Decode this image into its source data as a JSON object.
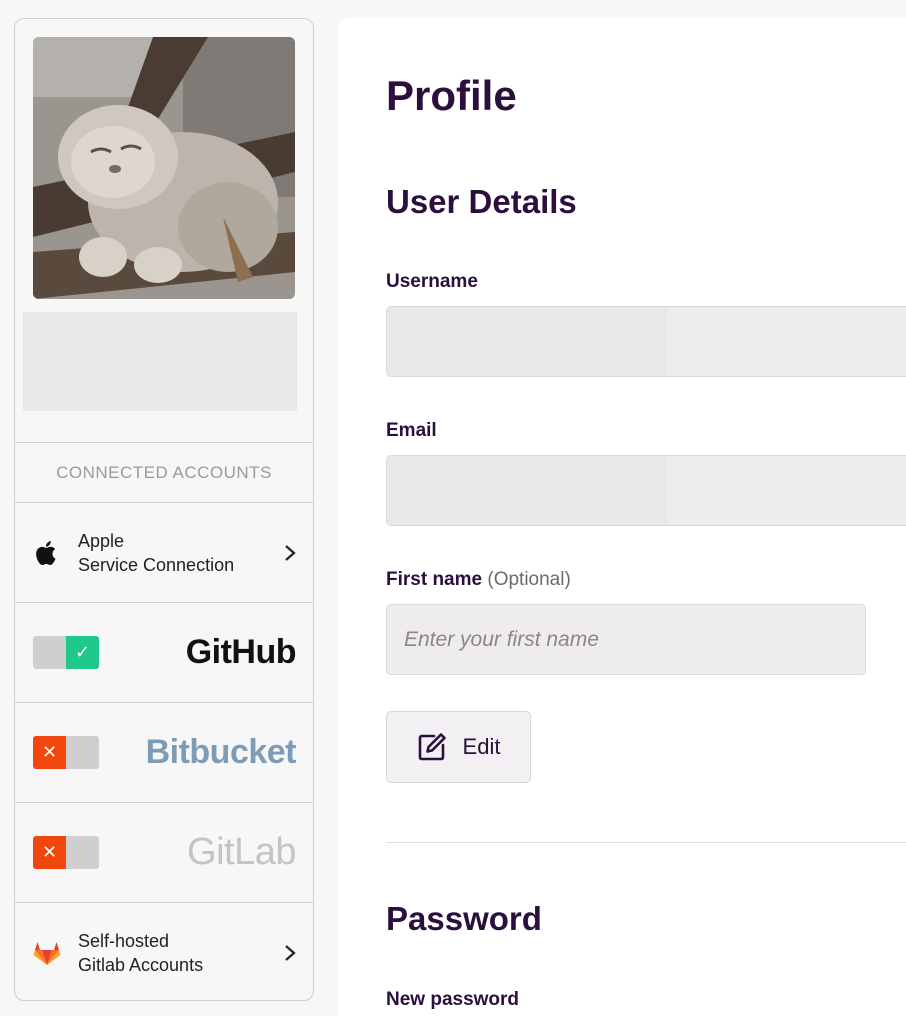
{
  "sidebar": {
    "connected_accounts_header": "CONNECTED ACCOUNTS",
    "apple": {
      "line1": "Apple",
      "line2": "Service Connection"
    },
    "github": {
      "brand": "GitHub",
      "status": "connected"
    },
    "bitbucket": {
      "brand": "Bitbucket",
      "status": "disconnected"
    },
    "gitlab": {
      "brand": "GitLab",
      "status": "disconnected"
    },
    "selfhosted": {
      "line1": "Self-hosted",
      "line2": "Gitlab Accounts"
    },
    "toggle_on_glyph": "✓",
    "toggle_off_glyph": "✕",
    "colors": {
      "toggle_on": "#1fc98a",
      "toggle_off": "#f2460f"
    }
  },
  "main": {
    "page_title": "Profile",
    "user_details_title": "User Details",
    "username_label": "Username",
    "email_label": "Email",
    "first_name_label": "First name",
    "first_name_optional": "(Optional)",
    "first_name_placeholder": "Enter your first name",
    "edit_label": "Edit",
    "password_title": "Password",
    "new_password_label": "New password"
  }
}
